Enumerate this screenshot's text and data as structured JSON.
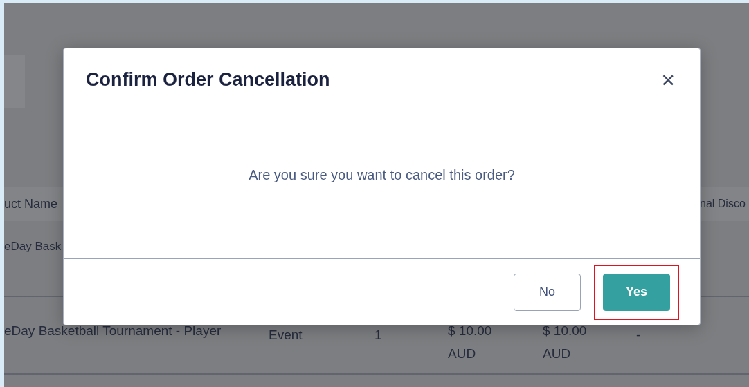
{
  "table": {
    "first_column": "uct Name",
    "last_column": "nal Disco",
    "rows": [
      {
        "cells": [
          "eDay Bask"
        ]
      },
      {
        "cells": [
          "eDay Basketball Tournament - Player",
          "Event",
          "1",
          "$ 10.00 AUD",
          "$ 10.00 AUD",
          "-"
        ]
      }
    ]
  },
  "dialog": {
    "title": "Confirm Order Cancellation",
    "close": "×",
    "message": "Are you sure you want to cancel this order?",
    "buttons": [
      {
        "label": "No",
        "kind": "secondary",
        "highlighted": false
      },
      {
        "label": "Yes",
        "kind": "primary",
        "highlighted": true
      }
    ]
  }
}
